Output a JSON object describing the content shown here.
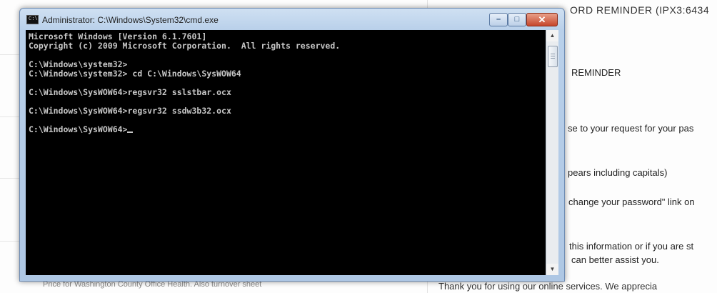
{
  "background": {
    "header": "ORD REMINDER (IPX3:6434",
    "left_footer": "Price for Washington County Office Health. Also turnover sheet",
    "right_lines": [
      "REMINDER",
      "se to your request for your pas",
      "pears including capitals)",
      "change your password\" link on",
      "this information or if you are st",
      "can better assist you."
    ],
    "right_footer": "Thank you for using our online services. We apprecia"
  },
  "window": {
    "title": "Administrator: C:\\Windows\\System32\\cmd.exe",
    "icon_label": "C:\\",
    "minimize_symbol": "–",
    "maximize_symbol": "□",
    "close_symbol": "✕"
  },
  "console": {
    "lines": [
      "Microsoft Windows [Version 6.1.7601]",
      "Copyright (c) 2009 Microsoft Corporation.  All rights reserved.",
      "",
      "C:\\Windows\\system32>",
      "C:\\Windows\\system32> cd C:\\Windows\\SysWOW64",
      "",
      "C:\\Windows\\SysWOW64>regsvr32 sslstbar.ocx",
      "",
      "C:\\Windows\\SysWOW64>regsvr32 ssdw3b32.ocx",
      "",
      "C:\\Windows\\SysWOW64>"
    ]
  },
  "scrollbar": {
    "up_arrow": "▲",
    "down_arrow": "▼"
  }
}
